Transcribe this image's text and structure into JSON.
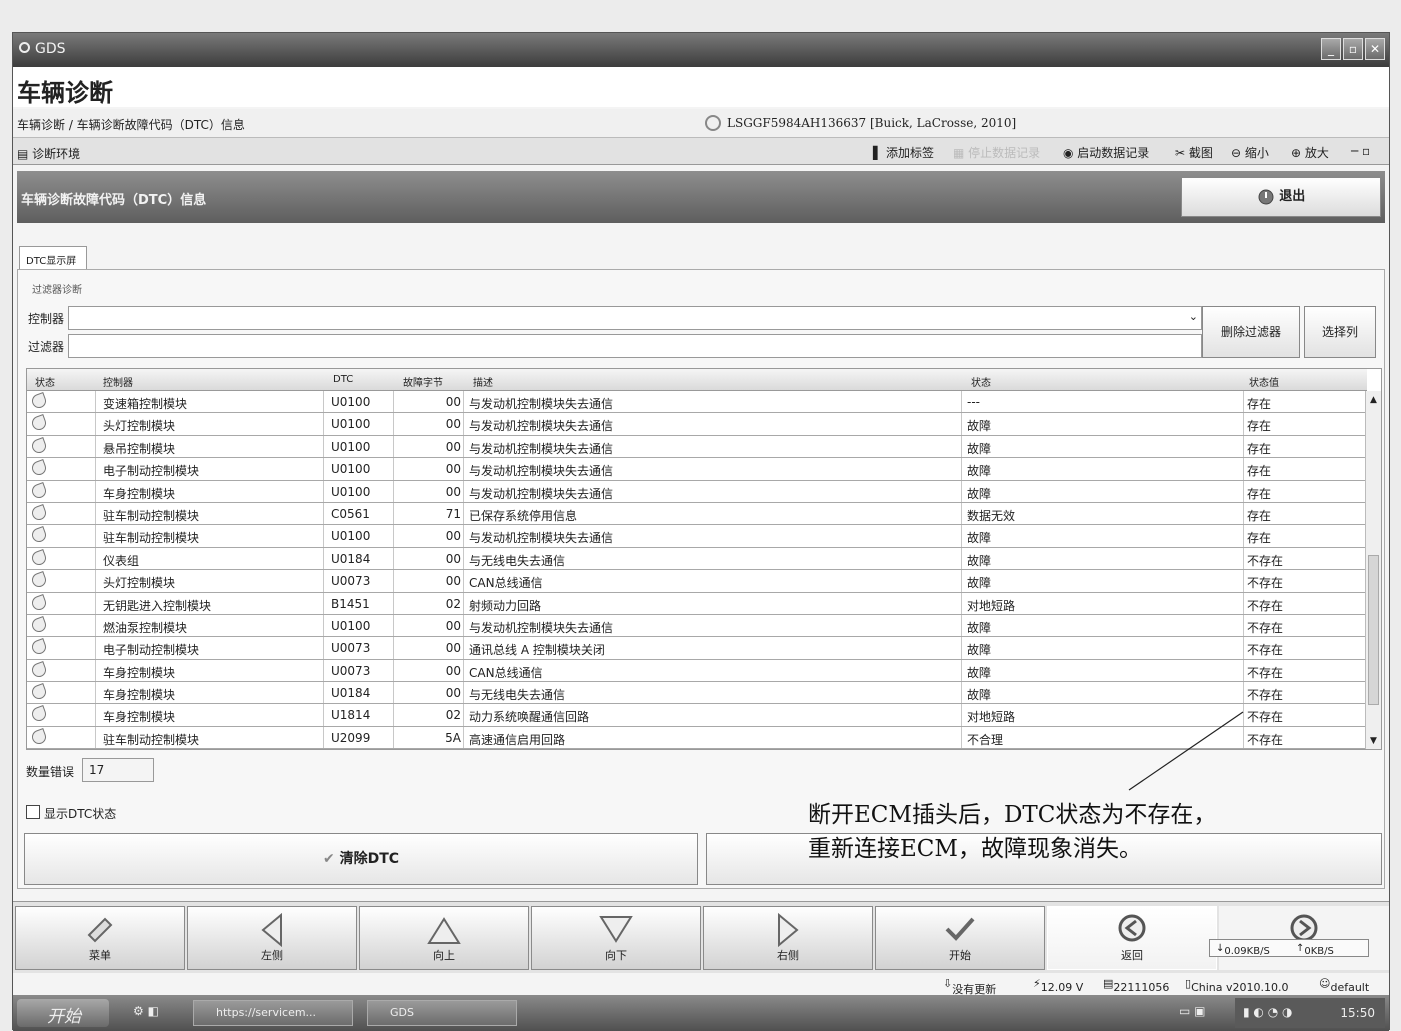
{
  "window": {
    "title": "GDS"
  },
  "app": {
    "heading": "车辆诊断"
  },
  "breadcrumb": {
    "path": "车辆诊断 / 车辆诊断故障代码（DTC）信息",
    "vehicle": "LSGGF5984AH136637 [Buick, LaCrosse, 2010]"
  },
  "env_tab": "诊断环境",
  "toolbar": {
    "add_tag": "添加标签",
    "stop_record": "停止数据记录",
    "start_record": "启动数据记录",
    "screenshot": "截图",
    "zoom_out": "缩小",
    "zoom_in": "放大"
  },
  "section": {
    "title": "车辆诊断故障代码（DTC）信息",
    "exit": "退出"
  },
  "tab": {
    "label": "DTC显示屏"
  },
  "filter": {
    "title": "过滤器诊断",
    "controller_label": "控制器",
    "filter_label": "过滤器",
    "clear_button": "删除过滤器",
    "select_columns": "选择列"
  },
  "table": {
    "headers": [
      "状态",
      "控制器",
      "DTC",
      "故障字节",
      "描述",
      "状态",
      "状态值"
    ],
    "rows": [
      {
        "controller": "变速箱控制模块",
        "dtc": "U0100",
        "byte": "00",
        "desc": "与发动机控制模块失去通信",
        "symptom": "---",
        "state": "存在"
      },
      {
        "controller": "头灯控制模块",
        "dtc": "U0100",
        "byte": "00",
        "desc": "与发动机控制模块失去通信",
        "symptom": "故障",
        "state": "存在"
      },
      {
        "controller": "悬吊控制模块",
        "dtc": "U0100",
        "byte": "00",
        "desc": "与发动机控制模块失去通信",
        "symptom": "故障",
        "state": "存在"
      },
      {
        "controller": "电子制动控制模块",
        "dtc": "U0100",
        "byte": "00",
        "desc": "与发动机控制模块失去通信",
        "symptom": "故障",
        "state": "存在"
      },
      {
        "controller": "车身控制模块",
        "dtc": "U0100",
        "byte": "00",
        "desc": "与发动机控制模块失去通信",
        "symptom": "故障",
        "state": "存在"
      },
      {
        "controller": "驻车制动控制模块",
        "dtc": "C0561",
        "byte": "71",
        "desc": "已保存系统停用信息",
        "symptom": "数据无效",
        "state": "存在"
      },
      {
        "controller": "驻车制动控制模块",
        "dtc": "U0100",
        "byte": "00",
        "desc": "与发动机控制模块失去通信",
        "symptom": "故障",
        "state": "存在"
      },
      {
        "controller": "仪表组",
        "dtc": "U0184",
        "byte": "00",
        "desc": "与无线电失去通信",
        "symptom": "故障",
        "state": "不存在"
      },
      {
        "controller": "头灯控制模块",
        "dtc": "U0073",
        "byte": "00",
        "desc": "CAN总线通信",
        "symptom": "故障",
        "state": "不存在"
      },
      {
        "controller": "无钥匙进入控制模块",
        "dtc": "B1451",
        "byte": "02",
        "desc": "射频动力回路",
        "symptom": "对地短路",
        "state": "不存在"
      },
      {
        "controller": "燃油泵控制模块",
        "dtc": "U0100",
        "byte": "00",
        "desc": "与发动机控制模块失去通信",
        "symptom": "故障",
        "state": "不存在"
      },
      {
        "controller": "电子制动控制模块",
        "dtc": "U0073",
        "byte": "00",
        "desc": "通讯总线 A 控制模块关闭",
        "symptom": "故障",
        "state": "不存在"
      },
      {
        "controller": "车身控制模块",
        "dtc": "U0073",
        "byte": "00",
        "desc": "CAN总线通信",
        "symptom": "故障",
        "state": "不存在"
      },
      {
        "controller": "车身控制模块",
        "dtc": "U0184",
        "byte": "00",
        "desc": "与无线电失去通信",
        "symptom": "故障",
        "state": "不存在"
      },
      {
        "controller": "车身控制模块",
        "dtc": "U1814",
        "byte": "02",
        "desc": "动力系统唤醒通信回路",
        "symptom": "对地短路",
        "state": "不存在"
      },
      {
        "controller": "驻车制动控制模块",
        "dtc": "U2099",
        "byte": "5A",
        "desc": "高速通信启用回路",
        "symptom": "不合理",
        "state": "不存在"
      }
    ]
  },
  "count": {
    "label": "数量错误",
    "value": "17"
  },
  "show_dtc_status": "显示DTC状态",
  "clear_dtc": "清除DTC",
  "annotation": {
    "line1": "断开ECM插头后，DTC状态为不存在，",
    "line2": "重新连接ECM，故障现象消失。"
  },
  "nav": {
    "menu": "菜单",
    "left": "左侧",
    "up": "向上",
    "down": "向下",
    "right": "右侧",
    "start": "开始",
    "back": "返回"
  },
  "net": {
    "down": "0.09KB/S",
    "up": "0KB/S"
  },
  "status": {
    "updates": "没有更新",
    "voltage": "12.09 V",
    "serial": "22111056",
    "region_version": "China v2010.10.0",
    "user": "default"
  },
  "taskbar": {
    "start": "开始",
    "browser": "https://servicem...",
    "app": "GDS",
    "clock": "15:50"
  }
}
